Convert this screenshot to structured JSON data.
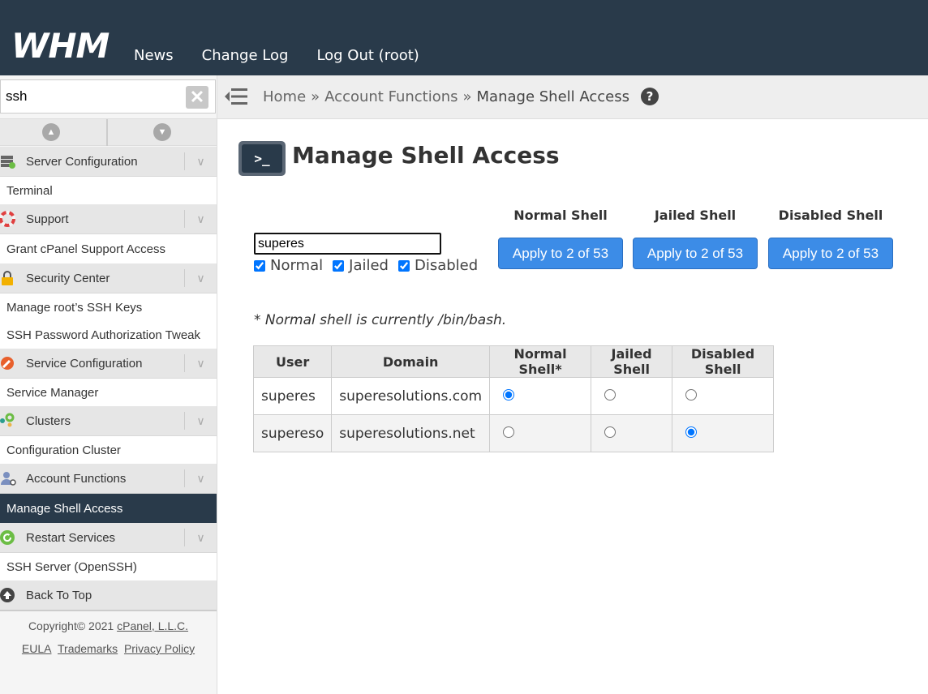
{
  "header": {
    "logo": "WHM",
    "nav": [
      "News",
      "Change Log",
      "Log Out (root)"
    ]
  },
  "sidebar": {
    "search_value": "ssh",
    "sections": [
      {
        "category": "Server Configuration",
        "icon": "server-config-icon",
        "items": [
          "Terminal"
        ]
      },
      {
        "category": "Support",
        "icon": "lifebuoy-icon",
        "items": [
          "Grant cPanel Support Access"
        ]
      },
      {
        "category": "Security Center",
        "icon": "lock-icon",
        "items": [
          "Manage root’s SSH Keys",
          "SSH Password Authorization Tweak"
        ]
      },
      {
        "category": "Service Configuration",
        "icon": "wrench-icon",
        "items": [
          "Service Manager"
        ]
      },
      {
        "category": "Clusters",
        "icon": "cluster-icon",
        "items": [
          "Configuration Cluster"
        ]
      },
      {
        "category": "Account Functions",
        "icon": "account-icon",
        "items": [
          "Manage Shell Access"
        ]
      },
      {
        "category": "Restart Services",
        "icon": "restart-icon",
        "items": [
          "SSH Server (OpenSSH)"
        ]
      }
    ],
    "back_to_top": "Back To Top",
    "copyright": "Copyright© 2021",
    "company_link": "cPanel, L.L.C.",
    "footer_links": [
      "EULA",
      "Trademarks",
      "Privacy Policy"
    ]
  },
  "breadcrumb": {
    "home": "Home",
    "sep": "»",
    "section": "Account Functions",
    "current": "Manage Shell Access"
  },
  "page": {
    "title": "Manage Shell Access",
    "icon_glyph": ">_",
    "filter_value": "superes",
    "checkboxes": [
      {
        "label": "Normal",
        "checked": true
      },
      {
        "label": "Jailed",
        "checked": true
      },
      {
        "label": "Disabled",
        "checked": true
      }
    ],
    "shell_columns": [
      {
        "header": "Normal Shell",
        "button": "Apply to 2 of 53"
      },
      {
        "header": "Jailed Shell",
        "button": "Apply to 2 of 53"
      },
      {
        "header": "Disabled Shell",
        "button": "Apply to 2 of 53"
      }
    ],
    "note": "* Normal shell is currently /bin/bash."
  },
  "table": {
    "headers": [
      "User",
      "Domain",
      "Normal Shell*",
      "Jailed Shell",
      "Disabled Shell"
    ],
    "rows": [
      {
        "user": "superes",
        "domain": "superesolutions.com",
        "selected": "normal"
      },
      {
        "user": "supereso",
        "domain": "superesolutions.net",
        "selected": "disabled"
      }
    ]
  },
  "colors": {
    "header_bg": "#293a4a",
    "button_blue": "#3c8ce7",
    "active_item_bg": "#293a4a"
  }
}
